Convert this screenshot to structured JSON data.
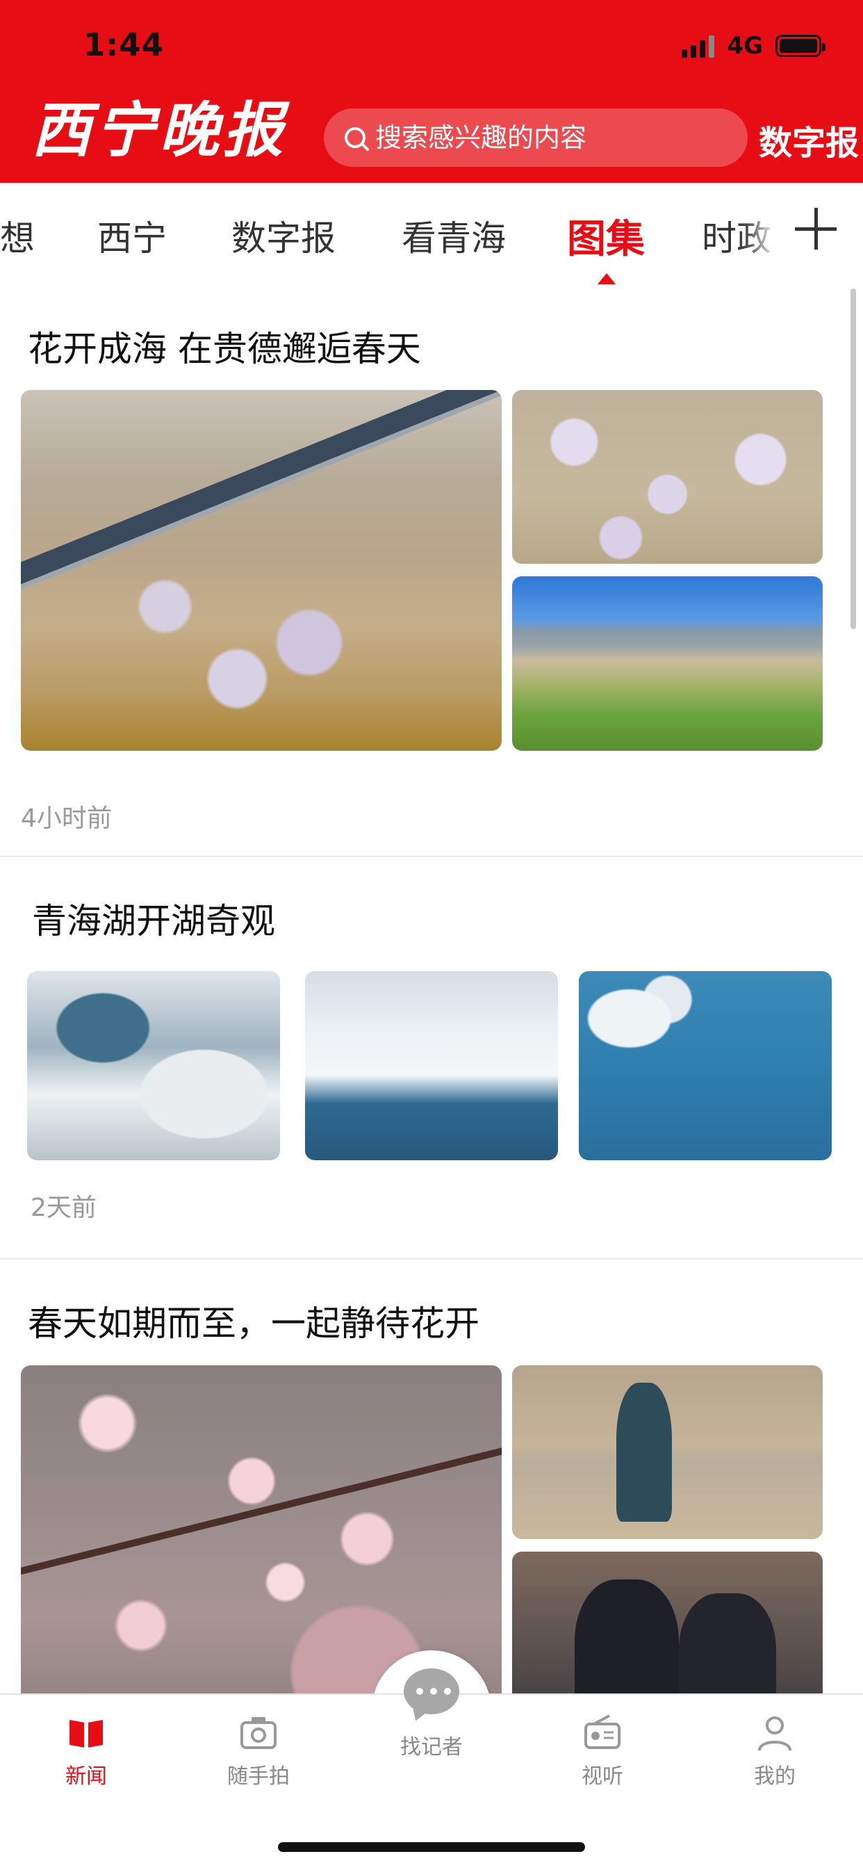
{
  "status": {
    "time": "1:44",
    "network": "4G"
  },
  "header": {
    "logo": "西宁晚报",
    "search_placeholder": "搜索感兴趣的内容",
    "digital_paper": "数字报"
  },
  "tabs": {
    "items": [
      {
        "label": "想"
      },
      {
        "label": "西宁"
      },
      {
        "label": "数字报"
      },
      {
        "label": "看青海"
      },
      {
        "label": "图集",
        "active": true
      },
      {
        "label": "时政"
      }
    ]
  },
  "feed": [
    {
      "title": "花开成海 在贵德邂逅春天",
      "time": "4小时前"
    },
    {
      "title": "青海湖开湖奇观",
      "time": "2天前"
    },
    {
      "title": "春天如期而至，一起静待花开"
    }
  ],
  "bottom_nav": {
    "items": [
      {
        "label": "新闻",
        "icon": "book-icon",
        "active": true
      },
      {
        "label": "随手拍",
        "icon": "camera-icon"
      },
      {
        "label": "找记者",
        "icon": "chat-bubble-icon"
      },
      {
        "label": "视听",
        "icon": "radio-icon"
      },
      {
        "label": "我的",
        "icon": "person-icon"
      }
    ]
  },
  "colors": {
    "brand": "#e60e14",
    "muted": "#999999"
  }
}
